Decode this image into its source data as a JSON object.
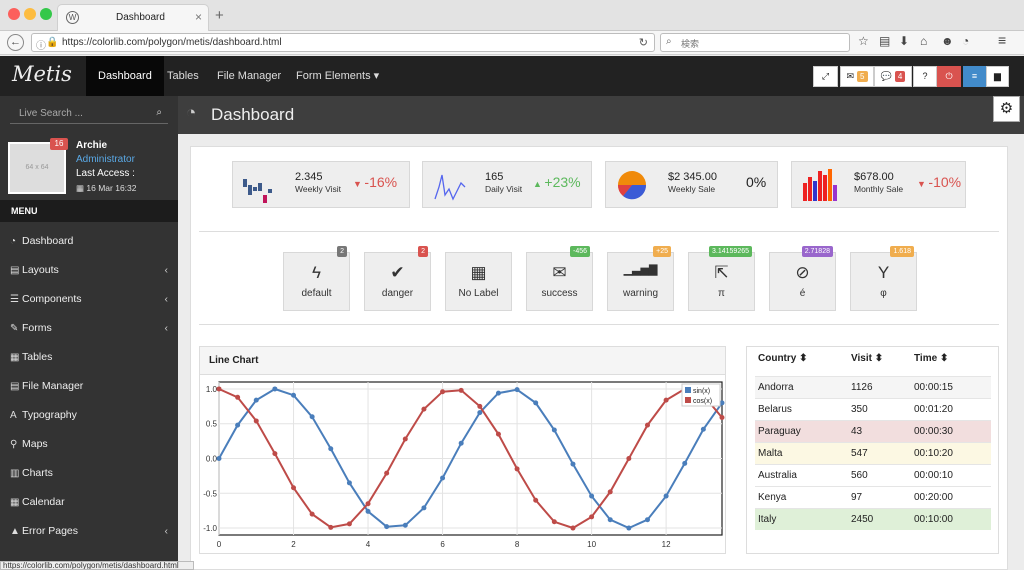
{
  "browser": {
    "tab_title": "Dashboard",
    "url": "https://colorlib.com/polygon/metis/dashboard.html",
    "search_placeholder": "検索",
    "status_url": "https://colorlib.com/polygon/metis/dashboard.html"
  },
  "header": {
    "logo": "Metis",
    "nav": [
      "Dashboard",
      "Tables",
      "File Manager",
      "Form Elements"
    ],
    "mail_count": "5",
    "comment_count": "4",
    "help_label": "?"
  },
  "sidebar": {
    "search_placeholder": "Live Search ...",
    "avatar_caption": "64 x 64",
    "avatar_badge": "16",
    "user_name": "Archie",
    "user_role": "Administrator",
    "last_access_label": "Last Access :",
    "last_access_date": "16 Mar 16:32",
    "menu_header": "MENU",
    "items": [
      {
        "label": "Dashboard",
        "icon": "dashboard-icon",
        "chevron": false
      },
      {
        "label": "Layouts",
        "icon": "file-icon",
        "chevron": true
      },
      {
        "label": "Components",
        "icon": "tasks-icon",
        "chevron": true
      },
      {
        "label": "Forms",
        "icon": "pencil-icon",
        "chevron": true
      },
      {
        "label": "Tables",
        "icon": "table-icon",
        "chevron": false
      },
      {
        "label": "File Manager",
        "icon": "file-icon",
        "chevron": false
      },
      {
        "label": "Typography",
        "icon": "font-icon",
        "chevron": false
      },
      {
        "label": "Maps",
        "icon": "map-marker-icon",
        "chevron": false
      },
      {
        "label": "Charts",
        "icon": "bar-chart-icon",
        "chevron": false
      },
      {
        "label": "Calendar",
        "icon": "calendar-icon",
        "chevron": false
      },
      {
        "label": "Error Pages",
        "icon": "warning-icon",
        "chevron": true
      }
    ]
  },
  "page": {
    "title": "Dashboard"
  },
  "stats": [
    {
      "value": "2.345",
      "label": "Weekly Visit",
      "change": "-16%",
      "dir": "down",
      "color": "#d9534f"
    },
    {
      "value": "165",
      "label": "Daily Visit",
      "change": "+23%",
      "dir": "up",
      "color": "#5cb85c"
    },
    {
      "value": "$2 345.00",
      "label": "Weekly Sale",
      "change": "0%",
      "dir": "none",
      "color": "#222222"
    },
    {
      "value": "$678.00",
      "label": "Monthly Sale",
      "change": "-10%",
      "dir": "down",
      "color": "#d9534f"
    }
  ],
  "quick_buttons": [
    {
      "label": "default",
      "badge": "2",
      "badge_color": "#777777",
      "icon": "bolt-icon",
      "glyph": "ϟ"
    },
    {
      "label": "danger",
      "badge": "2",
      "badge_color": "#d9534f",
      "icon": "check-icon",
      "glyph": "✔"
    },
    {
      "label": "No Label",
      "badge": "",
      "badge_color": "",
      "icon": "building-icon",
      "glyph": "▦"
    },
    {
      "label": "success",
      "badge": "-456",
      "badge_color": "#5cb85c",
      "icon": "envelope-icon",
      "glyph": "✉"
    },
    {
      "label": "warning",
      "badge": "+25",
      "badge_color": "#f0ad4e",
      "icon": "signal-icon",
      "glyph": "▁▃▅▇"
    },
    {
      "label": "π",
      "badge": "3.14159265",
      "badge_color": "#5cb85c",
      "icon": "external-link-icon",
      "glyph": "⇱"
    },
    {
      "label": "é",
      "badge": "2.71828",
      "badge_color": "#9966cc",
      "icon": "leaf-icon",
      "glyph": "⊘"
    },
    {
      "label": "φ",
      "badge": "1.618",
      "badge_color": "#f0ad4e",
      "icon": "glass-icon",
      "glyph": "Y"
    }
  ],
  "line_chart": {
    "title": "Line Chart"
  },
  "chart_data": {
    "type": "line",
    "title": "Line Chart",
    "xlim": [
      0,
      13.5
    ],
    "ylim": [
      -1.1,
      1.1
    ],
    "x_ticks": [
      0,
      2,
      4,
      6,
      8,
      10,
      12
    ],
    "y_ticks": [
      "1.0",
      "0.5",
      "0.0",
      "-0.5",
      "-1.0"
    ],
    "legend_position": "top-right",
    "grid": true,
    "series": [
      {
        "name": "sin(x)",
        "color": "#4a7ebb",
        "x": [
          0,
          0.5,
          1,
          1.5,
          2,
          2.5,
          3,
          3.5,
          4,
          4.5,
          5,
          5.5,
          6,
          6.5,
          7,
          7.5,
          8,
          8.5,
          9,
          9.5,
          10,
          10.5,
          11,
          11.5,
          12,
          12.5,
          13,
          13.5
        ],
        "y": [
          0,
          0.48,
          0.84,
          1.0,
          0.91,
          0.6,
          0.14,
          -0.35,
          -0.76,
          -0.98,
          -0.96,
          -0.71,
          -0.28,
          0.22,
          0.66,
          0.94,
          0.99,
          0.8,
          0.41,
          -0.08,
          -0.54,
          -0.88,
          -1.0,
          -0.88,
          -0.54,
          -0.07,
          0.42,
          0.8
        ]
      },
      {
        "name": "cos(x)",
        "color": "#be4b48",
        "x": [
          0,
          0.5,
          1,
          1.5,
          2,
          2.5,
          3,
          3.5,
          4,
          4.5,
          5,
          5.5,
          6,
          6.5,
          7,
          7.5,
          8,
          8.5,
          9,
          9.5,
          10,
          10.5,
          11,
          11.5,
          12,
          12.5,
          13,
          13.5
        ],
        "y": [
          1.0,
          0.88,
          0.54,
          0.07,
          -0.42,
          -0.8,
          -0.99,
          -0.94,
          -0.65,
          -0.21,
          0.28,
          0.71,
          0.96,
          0.98,
          0.75,
          0.35,
          -0.15,
          -0.6,
          -0.91,
          -1.0,
          -0.84,
          -0.48,
          0.0,
          0.48,
          0.84,
          1.0,
          0.91,
          0.59
        ]
      }
    ]
  },
  "table": {
    "headers": [
      "Country",
      "Visit",
      "Time"
    ],
    "rows": [
      {
        "country": "Andorra",
        "visit": "1126",
        "time": "00:00:15",
        "bg": "#f5f5f5"
      },
      {
        "country": "Belarus",
        "visit": "350",
        "time": "00:01:20",
        "bg": "#ffffff"
      },
      {
        "country": "Paraguay",
        "visit": "43",
        "time": "00:00:30",
        "bg": "#f2dede"
      },
      {
        "country": "Malta",
        "visit": "547",
        "time": "00:10:20",
        "bg": "#fcf8e3"
      },
      {
        "country": "Australia",
        "visit": "560",
        "time": "00:00:10",
        "bg": "#ffffff"
      },
      {
        "country": "Kenya",
        "visit": "97",
        "time": "00:20:00",
        "bg": "#ffffff"
      },
      {
        "country": "Italy",
        "visit": "2450",
        "time": "00:10:00",
        "bg": "#dff0d8"
      }
    ]
  }
}
